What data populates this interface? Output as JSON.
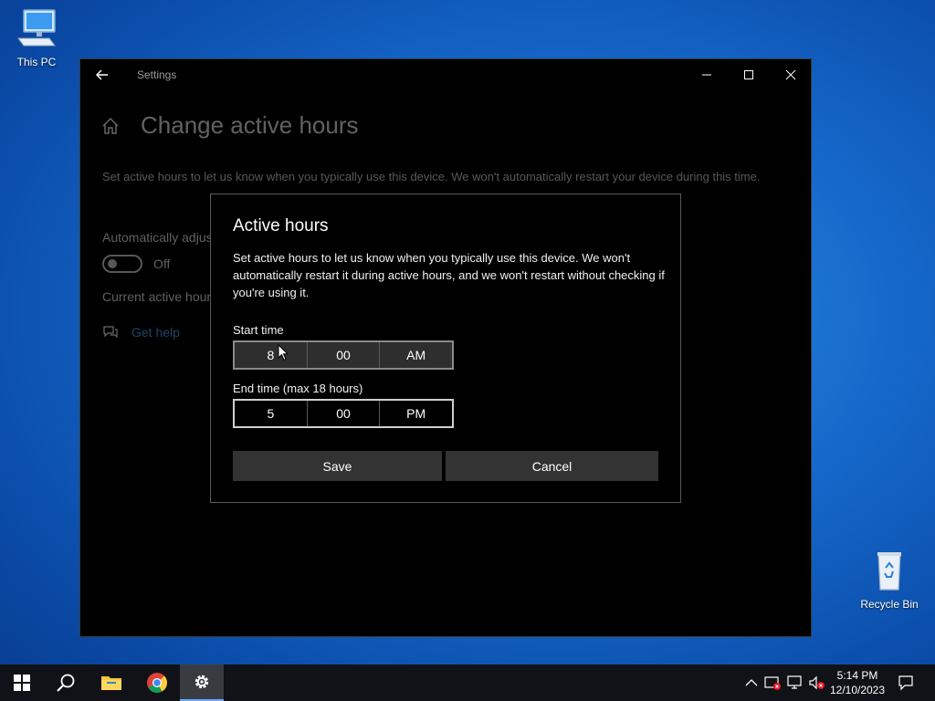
{
  "desktop": {
    "this_pc_label": "This PC",
    "recycle_bin_label": "Recycle Bin"
  },
  "window": {
    "title": "Settings",
    "page_title": "Change active hours",
    "page_description": "Set active hours to let us know when you typically use this device. We won't automatically restart your device during this time.",
    "auto_adjust_label": "Automatically adjus",
    "toggle_state_label": "Off",
    "current_active_label": "Current active hour",
    "get_help_label": "Get help"
  },
  "dialog": {
    "title": "Active hours",
    "description": "Set active hours to let us know when you typically use this device. We won't automatically restart it during active hours, and we won't restart without checking if you're using it.",
    "start_time": {
      "label": "Start time",
      "hour": "8",
      "minute": "00",
      "period": "AM"
    },
    "end_time": {
      "label": "End time (max 18 hours)",
      "hour": "5",
      "minute": "00",
      "period": "PM"
    },
    "save_label": "Save",
    "cancel_label": "Cancel"
  },
  "taskbar": {
    "clock_time": "5:14 PM",
    "clock_date": "12/10/2023"
  },
  "colors": {
    "accent": "#4aa3e8",
    "taskbar_bg": "#111217",
    "window_bg": "#000000"
  }
}
